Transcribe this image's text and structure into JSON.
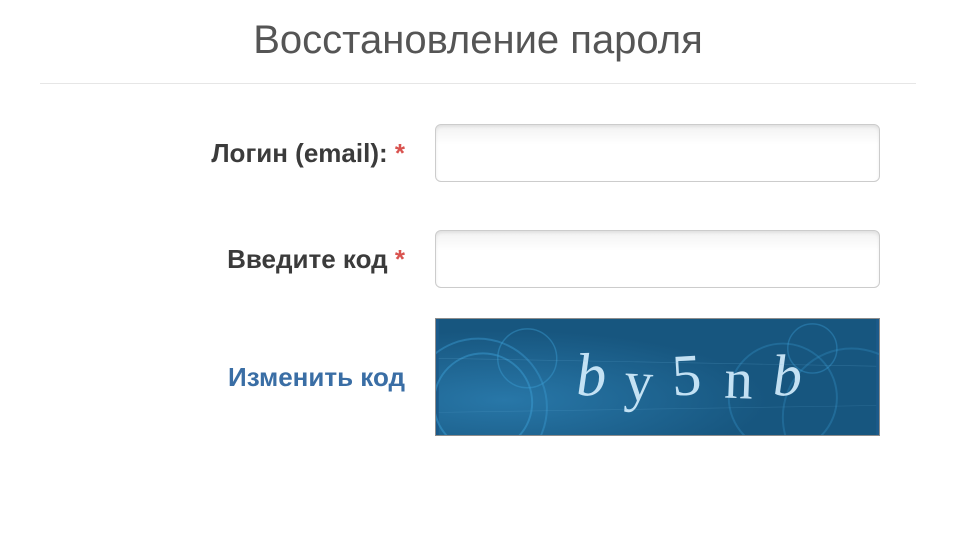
{
  "title": "Восстановление пароля",
  "form": {
    "loginLabel": "Логин (email):",
    "codeLabel": "Введите код",
    "required": "*",
    "loginValue": "",
    "codeValue": ""
  },
  "captcha": {
    "changeLink": "Изменить код",
    "text": "by5nb"
  }
}
